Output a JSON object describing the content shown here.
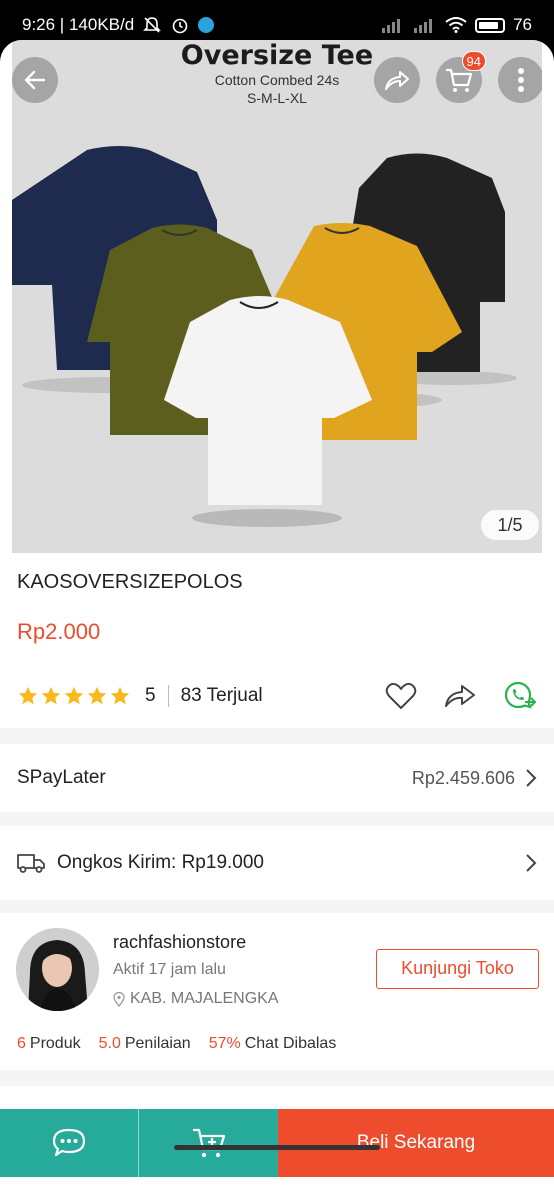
{
  "status_bar": {
    "time_speed": "9:26 | 140KB/d",
    "battery": "76"
  },
  "hero": {
    "title": "Oversize Tee",
    "subtitle1": "Cotton Combed 24s",
    "subtitle2": "S-M-L-XL",
    "cart_badge": "94",
    "image_counter": "1/5",
    "shirt_colors": [
      "#1e2a4e",
      "#5c5e1d",
      "#e1a41e",
      "#222222",
      "#f4f4f4"
    ]
  },
  "product": {
    "name": "KAOSOVERSIZEPOLOS",
    "price": "Rp2.000",
    "rating": "5",
    "sold": "83 Terjual",
    "star_color": "#f7b91b"
  },
  "paylater": {
    "label": "SPayLater",
    "value": "Rp2.459.606"
  },
  "shipping": {
    "label": "Ongkos Kirim: Rp19.000"
  },
  "shop": {
    "name": "rachfashionstore",
    "active": "Aktif 17 jam lalu",
    "location": "KAB. MAJALENGKA",
    "visit_button": "Kunjungi Toko",
    "stats": [
      {
        "num": "6",
        "label": "Produk"
      },
      {
        "num": "5.0",
        "label": "Penilaian"
      },
      {
        "num": "57%",
        "label": "Chat Dibalas"
      }
    ]
  },
  "bottom_bar": {
    "buy_label": "Beli Sekarang"
  },
  "colors": {
    "accent": "#ee4d2d",
    "teal": "#26aa99"
  }
}
